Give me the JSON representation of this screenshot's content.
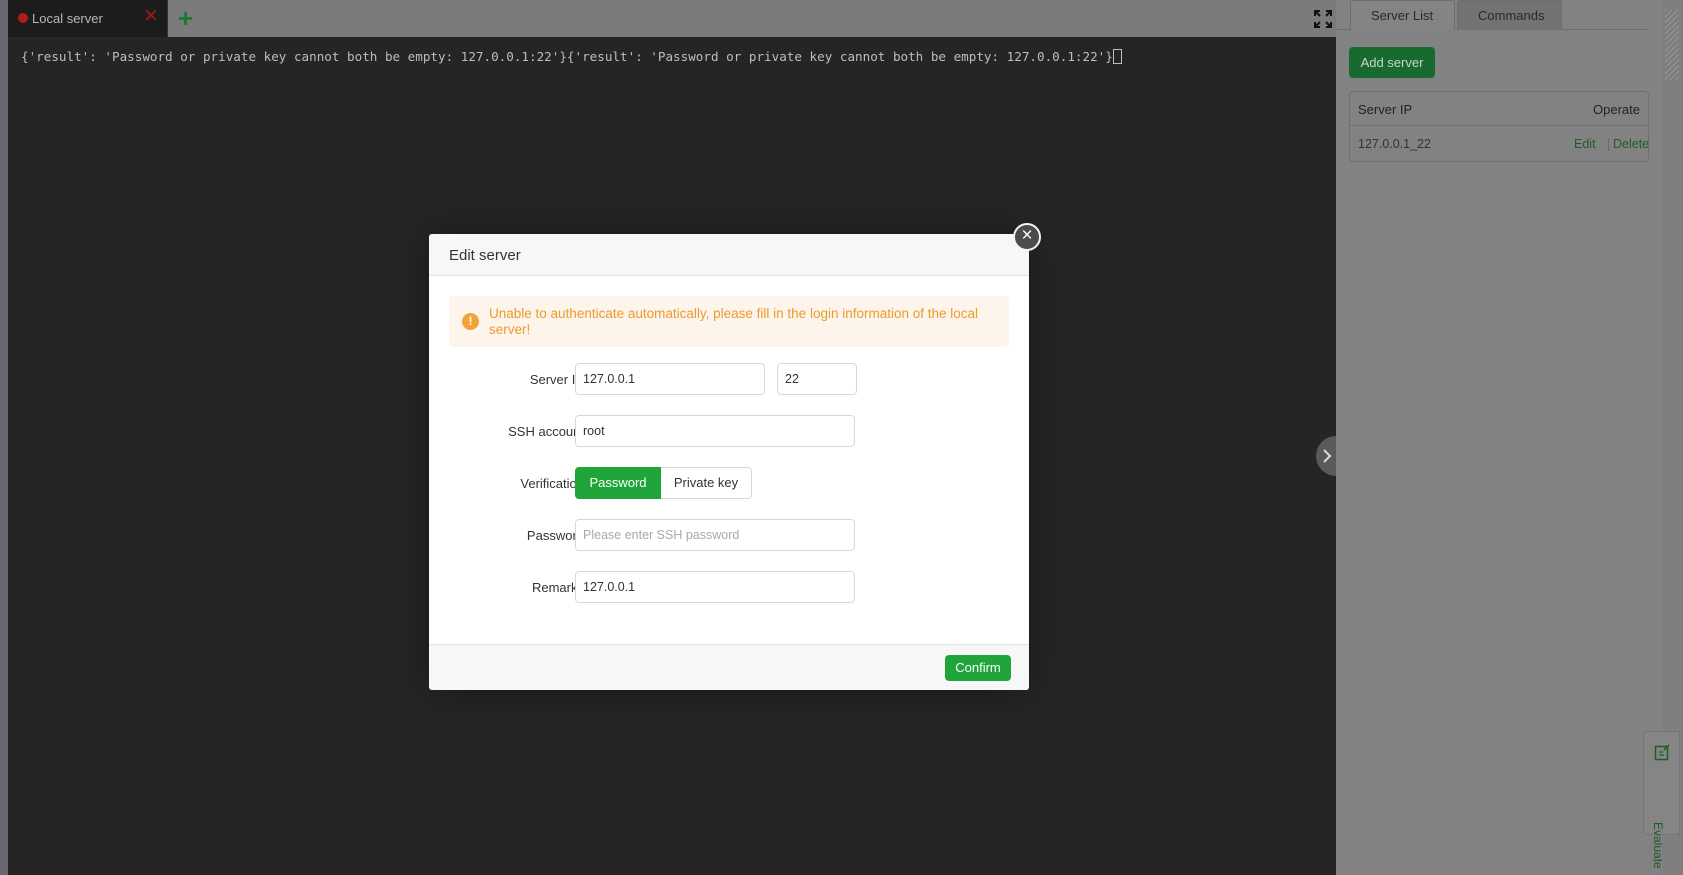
{
  "terminal": {
    "tab_label": "Local server",
    "tab_close": "✕",
    "add_tab": "+",
    "output": "{'result': 'Password or private key cannot both be empty: 127.0.0.1:22'}{'result': 'Password or private key cannot both be empty: 127.0.0.1:22'}"
  },
  "right_panel": {
    "tabs": [
      "Server List",
      "Commands"
    ],
    "active_tab": "Server List",
    "add_server_label": "Add server",
    "table": {
      "headers": [
        "Server IP",
        "Operate"
      ],
      "rows": [
        {
          "server_ip": "127.0.0.1_22",
          "edit": "Edit",
          "delete": "Delete"
        }
      ]
    },
    "evaluate_label": "Evaluate"
  },
  "modal": {
    "title": "Edit server",
    "close": "×",
    "alert": "Unable to authenticate automatically, please fill in the login information of the local server!",
    "fields": {
      "server_ip_label": "Server IP",
      "server_ip_value": "127.0.0.1",
      "port_value": "22",
      "ssh_account_label": "SSH account",
      "ssh_account_value": "root",
      "verification_label": "Verification",
      "verification_options": [
        "Password",
        "Private key"
      ],
      "verification_selected": "Password",
      "password_label": "Password",
      "password_placeholder": "Please enter SSH password",
      "remarks_label": "Remarks",
      "remarks_value": "127.0.0.1"
    },
    "confirm_label": "Confirm"
  },
  "colors": {
    "accent": "#20a53a",
    "warning": "#ec9a2c",
    "terminal_bg": "#252525"
  }
}
